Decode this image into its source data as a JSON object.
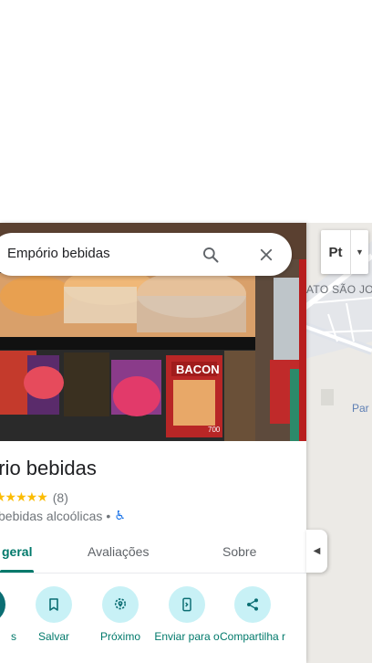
{
  "search": {
    "query": "Empório bebidas"
  },
  "place": {
    "name": "Empório bebidas",
    "name_visible": "ório bebidas",
    "stars": "★★★★★",
    "review_count": "(8)",
    "category": "bebidas alcoólicas",
    "separator": "•"
  },
  "tabs": [
    {
      "label": "geral"
    },
    {
      "label": "Avaliações"
    },
    {
      "label": "Sobre"
    }
  ],
  "actions": [
    {
      "label": "s"
    },
    {
      "label": "Salvar"
    },
    {
      "label": "Próximo"
    },
    {
      "label": "Enviar para o"
    },
    {
      "label": "Compartilha r"
    }
  ],
  "map": {
    "street_label": "ATO SÃO JO",
    "poi_label": "Par",
    "map_type_label": "Pt"
  },
  "photo": {
    "sign_text": "BACON",
    "package_text": "700"
  },
  "colors": {
    "accent": "#00796b",
    "action_bg": "#c8f1f6",
    "star": "#fbbc04"
  }
}
